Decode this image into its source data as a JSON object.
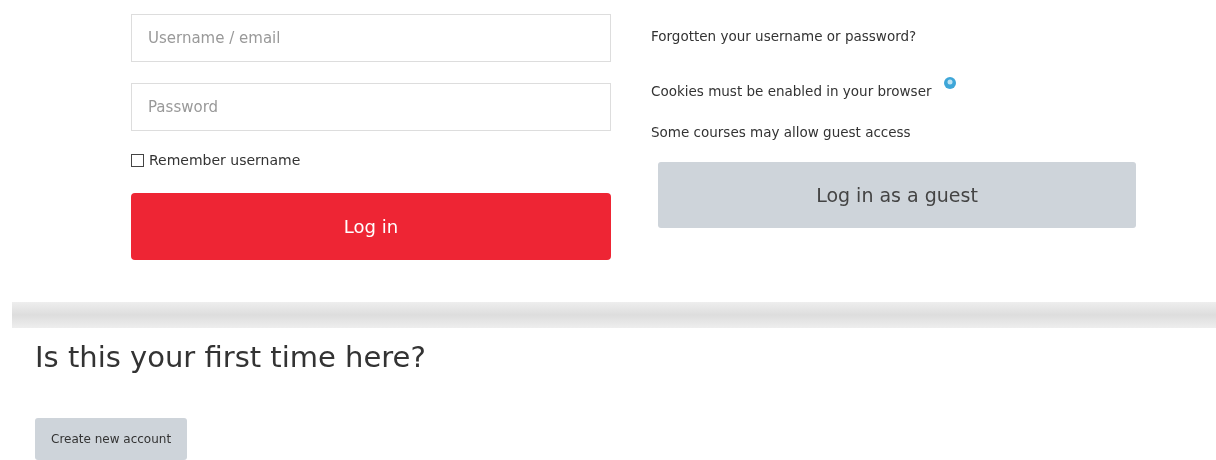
{
  "login_form": {
    "username": {
      "placeholder": "Username / email"
    },
    "password": {
      "placeholder": "Password"
    },
    "remember": {
      "label": "Remember username",
      "checked": false
    },
    "login_button": "Log in"
  },
  "info": {
    "forgot_link": "Forgotten your username or password?",
    "cookies_note": "Cookies must be enabled in your browser",
    "guest_note": "Some courses may allow guest access",
    "guest_button": "Log in as a guest"
  },
  "signup": {
    "heading": "Is this your first time here?",
    "button": "Create new account"
  }
}
